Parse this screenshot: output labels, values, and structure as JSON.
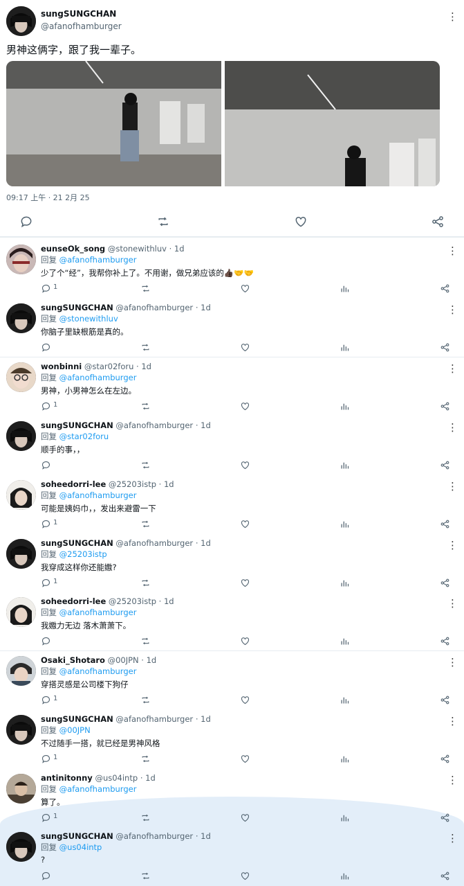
{
  "main_tweet": {
    "display_name": "sungSUNGCHAN",
    "handle": "@afanofhamburger",
    "text": "男神这俩字，跟了我一辈子。",
    "timestamp": "09:17 上午 · 21 2月 25",
    "more_icon": "⋮"
  },
  "colors": {
    "link": "#1d9bf0",
    "muted": "#536471",
    "text": "#0f1419",
    "highlight": "#e3eef9"
  },
  "replies": [
    {
      "name": "eunseOk_song",
      "handle": "@stonewithluv",
      "time": "· 1d",
      "reply_prefix": "回复",
      "reply_to": "@afanofhamburger",
      "text": "少了个“经”，我帮你补上了。不用谢，做兄弟应该的👍🏿🤝🤝",
      "reply_count": "1",
      "avatar": "avatar-1"
    },
    {
      "name": "sungSUNGCHAN",
      "handle": "@afanofhamburger",
      "time": "· 1d",
      "reply_prefix": "回复",
      "reply_to": "@stonewithluv",
      "text": "你脑子里缺根筋是真的。",
      "reply_count": "",
      "avatar": "avatar-main"
    },
    {
      "name": "wonbinni",
      "handle": "@star02foru",
      "time": "· 1d",
      "reply_prefix": "回复",
      "reply_to": "@afanofhamburger",
      "text": "男神，小男神怎么在左边。",
      "reply_count": "1",
      "avatar": "avatar-2"
    },
    {
      "name": "sungSUNGCHAN",
      "handle": "@afanofhamburger",
      "time": "· 1d",
      "reply_prefix": "回复",
      "reply_to": "@star02foru",
      "text": "顺手的事，，",
      "reply_count": "",
      "avatar": "avatar-main"
    },
    {
      "name": "soheedorri-lee",
      "handle": "@25203istp",
      "time": "· 1d",
      "reply_prefix": "回复",
      "reply_to": "@afanofhamburger",
      "text": "可能是姨妈巾，，发出来避雷一下",
      "reply_count": "1",
      "avatar": "avatar-3"
    },
    {
      "name": "sungSUNGCHAN",
      "handle": "@afanofhamburger",
      "time": "· 1d",
      "reply_prefix": "回复",
      "reply_to": "@25203istp",
      "text": "我穿成这样你还能嫐?",
      "reply_count": "1",
      "avatar": "avatar-main"
    },
    {
      "name": "soheedorri-lee",
      "handle": "@25203istp",
      "time": "· 1d",
      "reply_prefix": "回复",
      "reply_to": "@afanofhamburger",
      "text": "我嫐力无边 落木萧萧下。",
      "reply_count": "",
      "avatar": "avatar-3"
    },
    {
      "name": "Osaki_Shotaro",
      "handle": "@00JPN",
      "time": "· 1d",
      "reply_prefix": "回复",
      "reply_to": "@afanofhamburger",
      "text": "穿搭灵感是公司楼下狗仔",
      "reply_count": "1",
      "avatar": "avatar-4"
    },
    {
      "name": "sungSUNGCHAN",
      "handle": "@afanofhamburger",
      "time": "· 1d",
      "reply_prefix": "回复",
      "reply_to": "@00JPN",
      "text": "不过随手一搭，就已经是男神风格",
      "reply_count": "1",
      "avatar": "avatar-main"
    },
    {
      "name": "antinitonny",
      "handle": "@us04intp",
      "time": "· 1d",
      "reply_prefix": "回复",
      "reply_to": "@afanofhamburger",
      "text": "算了。",
      "reply_count": "1",
      "avatar": "avatar-5"
    },
    {
      "name": "sungSUNGCHAN",
      "handle": "@afanofhamburger",
      "time": "· 1d",
      "reply_prefix": "回复",
      "reply_to": "@us04intp",
      "text": "?",
      "reply_count": "",
      "avatar": "avatar-main"
    }
  ]
}
